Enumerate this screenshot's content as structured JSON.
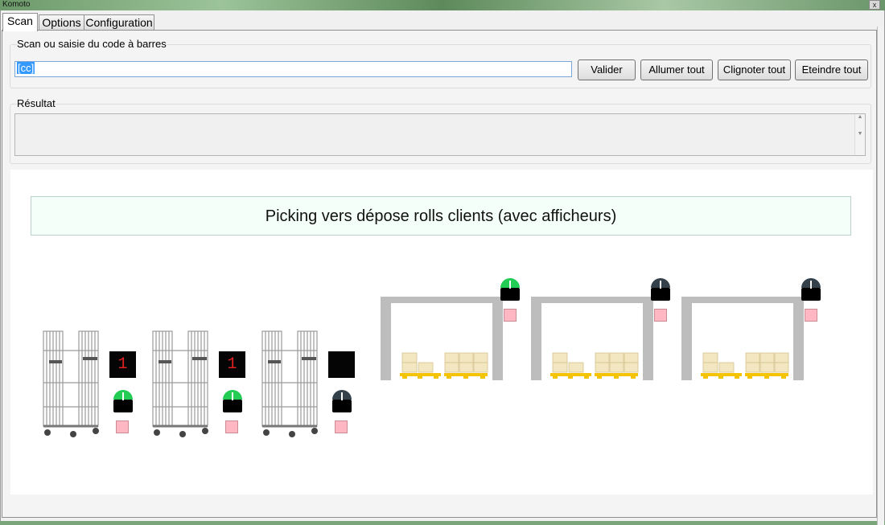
{
  "window": {
    "title": "Komoto",
    "close_label": "x"
  },
  "tabs": [
    {
      "label": "Scan",
      "active": true
    },
    {
      "label": "Options",
      "active": false
    },
    {
      "label": "Configuration",
      "active": false
    }
  ],
  "scan": {
    "legend": "Scan ou saisie du code à barres",
    "input_value": "[cc]",
    "buttons": {
      "validate": "Valider",
      "all_on": "Allumer tout",
      "blink_all": "Clignoter tout",
      "all_off": "Eteindre tout"
    }
  },
  "result": {
    "legend": "Résultat",
    "value": ""
  },
  "canvas": {
    "banner": "Picking vers dépose rolls clients (avec afficheurs)",
    "rolls": [
      {
        "display": "1",
        "lamp": "green"
      },
      {
        "display": "1",
        "lamp": "green"
      },
      {
        "display": "",
        "lamp": "off"
      }
    ],
    "bays": [
      {
        "lamp": "green"
      },
      {
        "lamp": "off"
      },
      {
        "lamp": "off"
      }
    ]
  },
  "colors": {
    "lamp_green": "#22cc55",
    "lamp_off": "#35414a",
    "display_digit": "#e02020",
    "pallet": "#f5c400"
  },
  "icons": [
    "roll-cage-icon",
    "status-lamp-icon",
    "pallet-icon"
  ]
}
